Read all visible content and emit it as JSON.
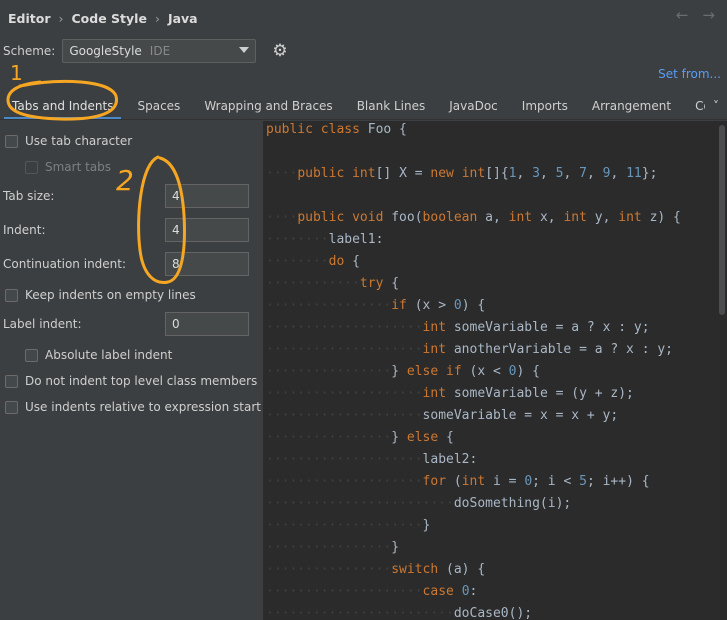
{
  "breadcrumb": {
    "items": [
      "Editor",
      "Code Style",
      "Java"
    ]
  },
  "nav": {
    "back": "←",
    "forward": "→"
  },
  "scheme": {
    "label": "Scheme:",
    "value": "GoogleStyle",
    "scope": "IDE"
  },
  "set_from": "Set from...",
  "tabs": [
    "Tabs and Indents",
    "Spaces",
    "Wrapping and Braces",
    "Blank Lines",
    "JavaDoc",
    "Imports",
    "Arrangement",
    "Code Ge"
  ],
  "tabs_more": "˅",
  "options": {
    "use_tab_character": "Use tab character",
    "smart_tabs": "Smart tabs",
    "tab_size_label": "Tab size:",
    "tab_size": "4",
    "indent_label": "Indent:",
    "indent": "4",
    "continuation_indent_label": "Continuation indent:",
    "continuation_indent": "8",
    "keep_indents": "Keep indents on empty lines",
    "label_indent_label": "Label indent:",
    "label_indent": "0",
    "absolute_label_indent": "Absolute label indent",
    "no_indent_top_level": "Do not indent top level class members",
    "indents_relative": "Use indents relative to expression start"
  },
  "annotations": {
    "one": "1",
    "two": "2",
    "color": "#f5a623"
  },
  "colors": {
    "keyword": "#cc7832",
    "number": "#6897bb",
    "text": "#a9b7c6",
    "accent": "#4a88c7",
    "link": "#589df6"
  },
  "code": {
    "l1": [
      [
        "kw",
        "public class "
      ],
      [
        "p",
        "Foo {"
      ]
    ],
    "l2": [
      [
        "ws",
        "····"
      ],
      [
        "kw",
        "public int"
      ],
      [
        "p",
        "[] X = "
      ],
      [
        "kw",
        "new int"
      ],
      [
        "p",
        "[]{"
      ],
      [
        "n",
        "1"
      ],
      [
        "p",
        ", "
      ],
      [
        "n",
        "3"
      ],
      [
        "p",
        ", "
      ],
      [
        "n",
        "5"
      ],
      [
        "p",
        ", "
      ],
      [
        "n",
        "7"
      ],
      [
        "p",
        ", "
      ],
      [
        "n",
        "9"
      ],
      [
        "p",
        ", "
      ],
      [
        "n",
        "11"
      ],
      [
        "p",
        "};"
      ]
    ],
    "l3": [
      [
        "ws",
        "····"
      ],
      [
        "kw",
        "public void "
      ],
      [
        "p",
        "foo("
      ],
      [
        "kw",
        "boolean "
      ],
      [
        "p",
        "a, "
      ],
      [
        "kw",
        "int "
      ],
      [
        "p",
        "x, "
      ],
      [
        "kw",
        "int "
      ],
      [
        "p",
        "y, "
      ],
      [
        "kw",
        "int "
      ],
      [
        "p",
        "z) {"
      ]
    ],
    "l4": [
      [
        "ws",
        "········"
      ],
      [
        "p",
        "label1:"
      ]
    ],
    "l5": [
      [
        "ws",
        "········"
      ],
      [
        "kw",
        "do "
      ],
      [
        "p",
        "{"
      ]
    ],
    "l6": [
      [
        "ws",
        "············"
      ],
      [
        "kw",
        "try "
      ],
      [
        "p",
        "{"
      ]
    ],
    "l7": [
      [
        "ws",
        "················"
      ],
      [
        "kw",
        "if "
      ],
      [
        "p",
        "(x > "
      ],
      [
        "n",
        "0"
      ],
      [
        "p",
        ") {"
      ]
    ],
    "l8": [
      [
        "ws",
        "····················"
      ],
      [
        "kw",
        "int "
      ],
      [
        "p",
        "someVariable = a ? x : y;"
      ]
    ],
    "l9": [
      [
        "ws",
        "····················"
      ],
      [
        "kw",
        "int "
      ],
      [
        "p",
        "anotherVariable = a ? x : y;"
      ]
    ],
    "l10": [
      [
        "ws",
        "················"
      ],
      [
        "p",
        "} "
      ],
      [
        "kw",
        "else if "
      ],
      [
        "p",
        "(x < "
      ],
      [
        "n",
        "0"
      ],
      [
        "p",
        ") {"
      ]
    ],
    "l11": [
      [
        "ws",
        "····················"
      ],
      [
        "kw",
        "int "
      ],
      [
        "p",
        "someVariable = (y + z);"
      ]
    ],
    "l12": [
      [
        "ws",
        "····················"
      ],
      [
        "p",
        "someVariable = x = x + y;"
      ]
    ],
    "l13": [
      [
        "ws",
        "················"
      ],
      [
        "p",
        "} "
      ],
      [
        "kw",
        "else "
      ],
      [
        "p",
        "{"
      ]
    ],
    "l14": [
      [
        "ws",
        "····················"
      ],
      [
        "p",
        "label2:"
      ]
    ],
    "l15": [
      [
        "ws",
        "····················"
      ],
      [
        "kw",
        "for "
      ],
      [
        "p",
        "("
      ],
      [
        "kw",
        "int "
      ],
      [
        "p",
        "i = "
      ],
      [
        "n",
        "0"
      ],
      [
        "p",
        "; i < "
      ],
      [
        "n",
        "5"
      ],
      [
        "p",
        "; i++) {"
      ]
    ],
    "l16": [
      [
        "ws",
        "························"
      ],
      [
        "p",
        "doSomething(i);"
      ]
    ],
    "l17": [
      [
        "ws",
        "····················"
      ],
      [
        "p",
        "}"
      ]
    ],
    "l18": [
      [
        "ws",
        "················"
      ],
      [
        "p",
        "}"
      ]
    ],
    "l19": [
      [
        "ws",
        "················"
      ],
      [
        "kw",
        "switch "
      ],
      [
        "p",
        "(a) {"
      ]
    ],
    "l20": [
      [
        "ws",
        "····················"
      ],
      [
        "kw",
        "case "
      ],
      [
        "n",
        "0"
      ],
      [
        "p",
        ":"
      ]
    ],
    "l21": [
      [
        "ws",
        "························"
      ],
      [
        "p",
        "doCase0();"
      ]
    ]
  }
}
